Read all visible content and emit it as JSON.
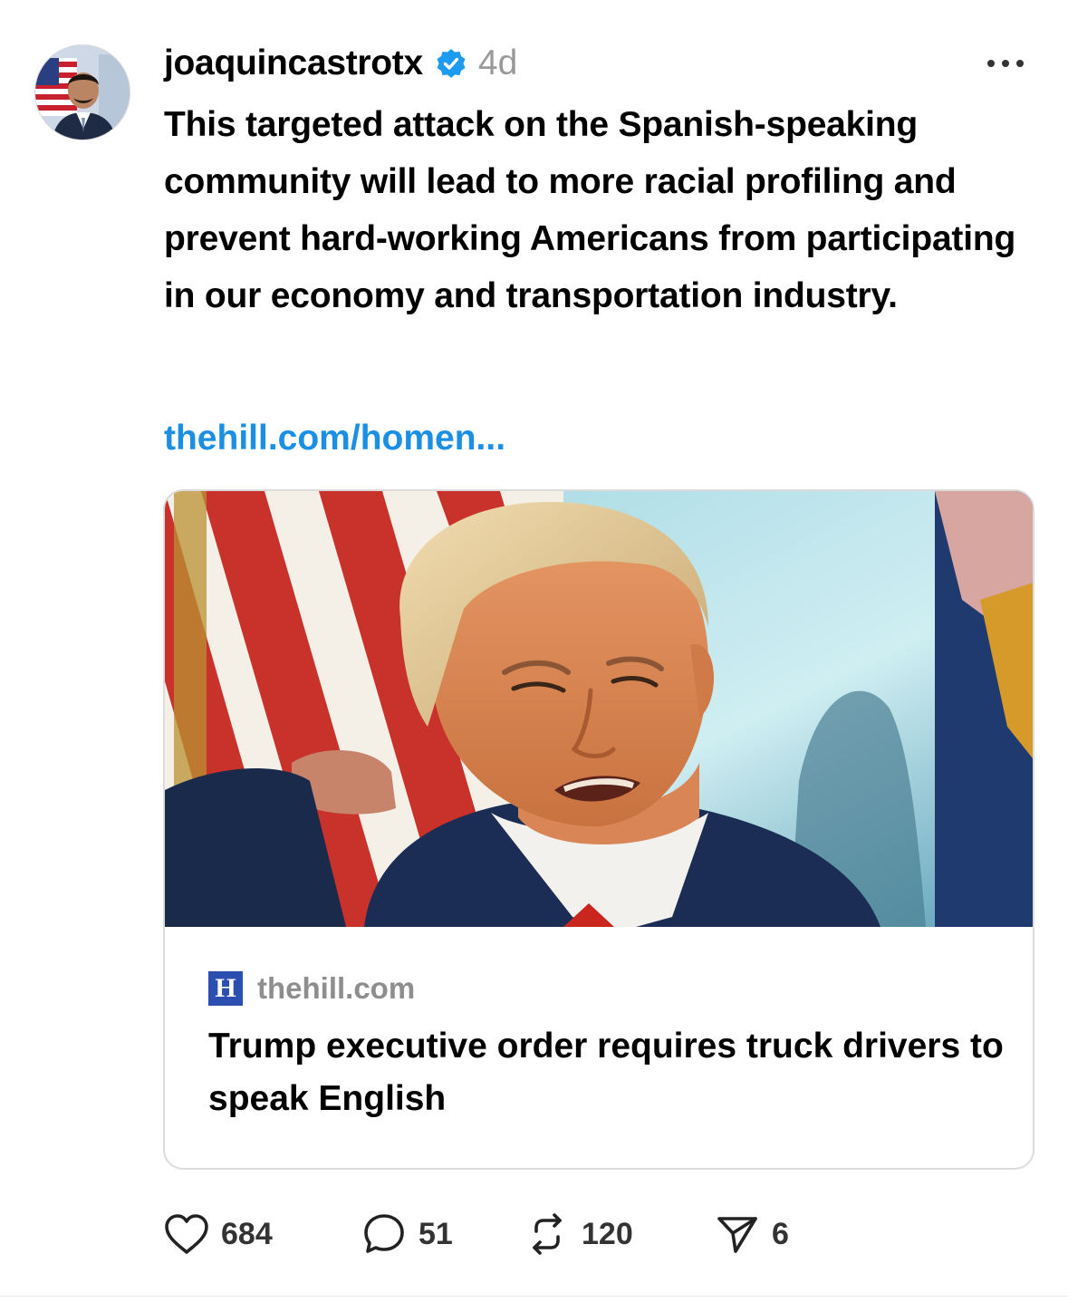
{
  "post": {
    "username": "joaquincastrotx",
    "verified": true,
    "timestamp": "4d",
    "text": "This targeted attack on the Spanish-speaking community will lead to more racial profiling and prevent hard-working Americans from participating in our economy and transportation industry.",
    "link_text": "thehill.com/homen..."
  },
  "link_card": {
    "source_logo_letter": "H",
    "source_domain": "thehill.com",
    "headline": "Trump executive order requires truck drivers to speak English"
  },
  "actions": {
    "likes": "684",
    "replies": "51",
    "reposts": "120",
    "shares": "6"
  },
  "icons": {
    "verified": "verified-badge-icon",
    "more": "more-dots-icon",
    "like": "heart-icon",
    "reply": "comment-bubble-icon",
    "repost": "repost-icon",
    "share": "send-icon"
  },
  "colors": {
    "link": "#1a8fe3",
    "verified": "#1d9bf0",
    "muted_text": "#999999",
    "source_logo": "#2b4fb0"
  }
}
